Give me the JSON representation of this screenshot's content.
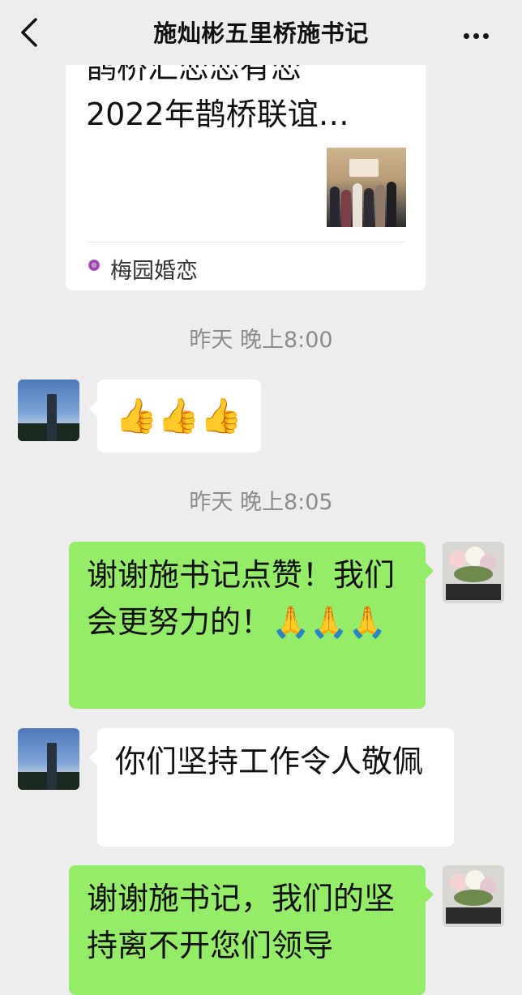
{
  "header": {
    "title": "施灿彬五里桥施书记",
    "back_icon": "chevron-left-icon",
    "more_icon": "more-dots-icon"
  },
  "messages": {
    "link_card": {
      "title_top_cut": "鹊桥汇恋恋有恋",
      "title_line": "2022年鹊桥联谊…",
      "source_name": "梅园婚恋",
      "source_icon": "flower-logo-icon"
    },
    "time_1": "昨天 晚上8:00",
    "msg_1": "👍👍👍",
    "time_2": "昨天 晚上8:05",
    "msg_2": "谢谢施书记点赞！我们会更努力的！🙏🙏🙏",
    "msg_3": "你们坚持工作令人敬佩",
    "msg_4": "谢谢施书记，我们的坚持离不开您们领导"
  },
  "colors": {
    "background": "#ededed",
    "outgoing_bubble": "#95ec69",
    "incoming_bubble": "#ffffff",
    "timestamp": "#8c8c8c"
  }
}
